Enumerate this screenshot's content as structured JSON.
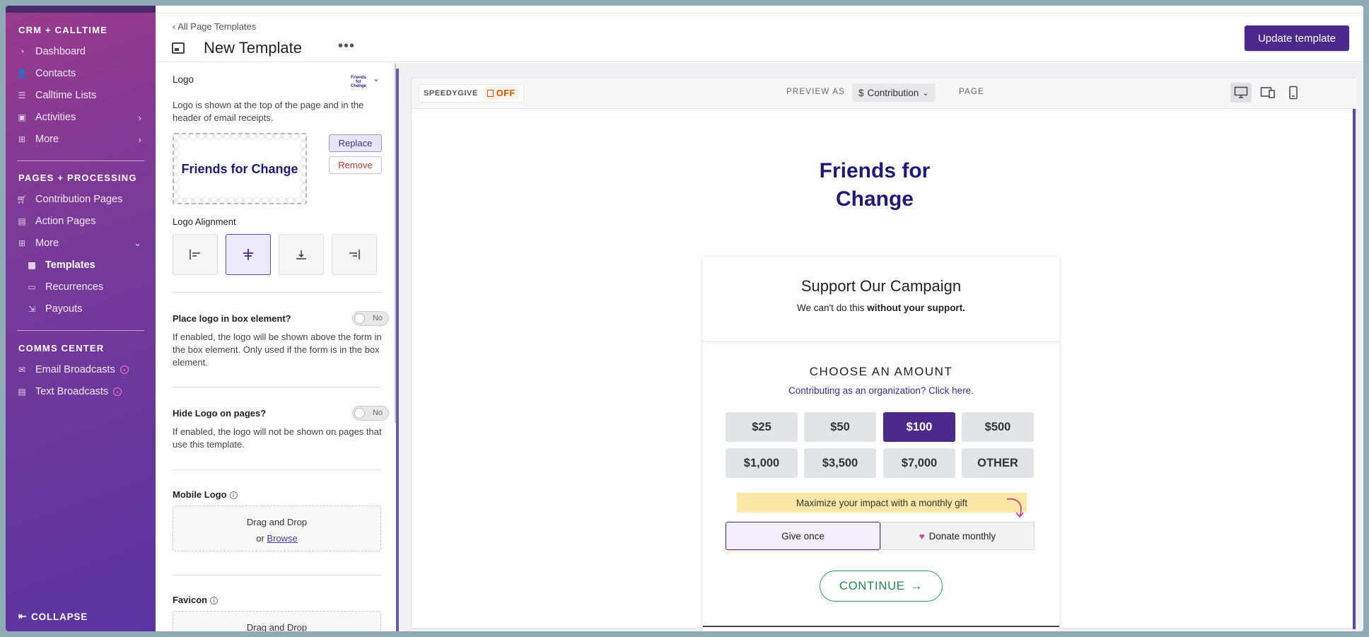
{
  "sidebar": {
    "crm_title": "CRM + CALLTIME",
    "crm_items": [
      {
        "label": "Dashboard",
        "icon": "dashboard-icon"
      },
      {
        "label": "Contacts",
        "icon": "contacts-icon"
      },
      {
        "label": "Calltime Lists",
        "icon": "list-icon"
      },
      {
        "label": "Activities",
        "icon": "activities-icon"
      },
      {
        "label": "More",
        "icon": "more-icon"
      }
    ],
    "pages_title": "PAGES + PROCESSING",
    "pages_items": [
      {
        "label": "Contribution Pages",
        "icon": "cart-icon"
      },
      {
        "label": "Action Pages",
        "icon": "action-icon"
      },
      {
        "label": "More",
        "icon": "more-icon"
      }
    ],
    "pages_sub_items": [
      {
        "label": "Templates",
        "icon": "template-icon"
      },
      {
        "label": "Recurrences",
        "icon": "recurrence-icon"
      },
      {
        "label": "Payouts",
        "icon": "payout-icon"
      }
    ],
    "comms_title": "COMMS CENTER",
    "comms_items": [
      {
        "label": "Email Broadcasts",
        "icon": "email-icon"
      },
      {
        "label": "Text Broadcasts",
        "icon": "text-icon"
      }
    ],
    "collapse_label": "COLLAPSE"
  },
  "header": {
    "breadcrumb": "‹ All Page Templates",
    "title": "New Template",
    "more": "•••",
    "update_button": "Update template"
  },
  "panel": {
    "logo_label": "Logo",
    "logo_mini_text": "Friends for Change",
    "logo_desc": "Logo is shown at the top of the page and in the header of email receipts.",
    "logo_preview_text": "Friends for Change",
    "replace_button": "Replace",
    "remove_button": "Remove",
    "alignment_label": "Logo Alignment",
    "box_label": "Place logo in box element?",
    "box_toggle": "No",
    "box_desc": "If enabled, the logo will be shown above the form in the box element. Only used if the form is in the box element.",
    "hide_label": "Hide Logo on pages?",
    "hide_toggle": "No",
    "hide_desc": "If enabled, the logo will not be shown on pages that use this template.",
    "mobile_logo_label": "Mobile Logo",
    "favicon_label": "Favicon",
    "drag_drop": "Drag and Drop",
    "or_text": "or",
    "browse": "Browse"
  },
  "preview": {
    "speedygive": "SPEEDYGIVE",
    "speedygive_status": "OFF",
    "preview_as": "PREVIEW AS",
    "preview_type": "Contribution",
    "currency_symbol": "$",
    "page_label": "PAGE",
    "org_name": "Friends for Change",
    "card_title": "Support Our Campaign",
    "card_sub_plain": "We can't do this",
    "card_sub_bold": "without your support.",
    "choose_amount": "CHOOSE AN AMOUNT",
    "org_link": "Contributing as an organization? Click here.",
    "amounts": [
      "$25",
      "$50",
      "$100",
      "$500",
      "$1,000",
      "$3,500",
      "$7,000",
      "OTHER"
    ],
    "selected_amount": "$100",
    "banner": "Maximize your impact with a monthly gift",
    "give_once": "Give once",
    "donate_monthly": "Donate monthly",
    "continue": "CONTINUE"
  },
  "colors": {
    "brand_purple": "#4c2a8c",
    "logo_navy": "#1e1a78",
    "continue_green": "#1e8a4a",
    "banner_yellow": "#fbe7a6",
    "heart_pink": "#e0359a"
  }
}
